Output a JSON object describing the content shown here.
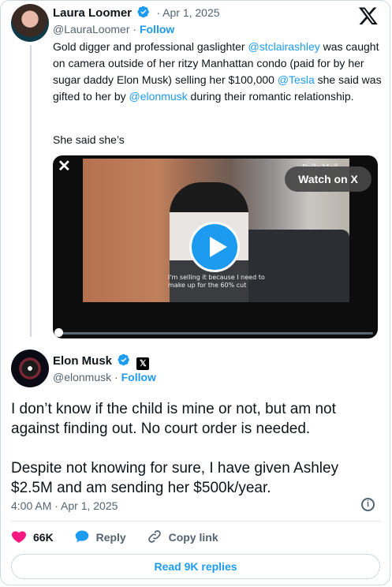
{
  "quoted_tweet": {
    "author_name": "Laura Loomer",
    "date": "· Apr 1, 2025",
    "handle": "@LauraLoomer",
    "separator": "·",
    "follow": "Follow",
    "text_part1": "Gold digger and professional gaslighter ",
    "mention1": "@stclairashley",
    "text_part2": " was caught on camera outside of her ritzy Manhattan condo (paid for by her sugar daddy Elon Musk) selling her $100,000 ",
    "mention2": "@Tesla",
    "text_part3": " she said was gifted to her by ",
    "mention3": "@elonmusk",
    "text_part4": " during their romantic relationship.",
    "text_line2": "She said she’s",
    "video": {
      "watch_label": "Watch on X",
      "subtitle": "I'm selling it because I need to make up for the 60% cut",
      "source_logo": "Daily Mail",
      "progress": 0.01
    }
  },
  "tweet": {
    "author_name": "Elon Musk",
    "handle": "@elonmusk",
    "separator": "·",
    "follow": "Follow",
    "paragraph1": "I don’t know if the child is mine or not, but am not against finding out. No court order is needed.",
    "paragraph2": "Despite not knowing for sure, I have given Ashley $2.5M and am sending her $500k/year.",
    "timestamp": "4:00 AM · Apr 1, 2025"
  },
  "actions": {
    "likes": "66K",
    "reply": "Reply",
    "copy_link": "Copy link"
  },
  "read_replies": "Read 9K replies",
  "colors": {
    "accent": "#1d9bf0",
    "like": "#f91880",
    "text": "#0f1419",
    "muted": "#536471"
  },
  "icons": [
    "x-logo-icon",
    "verified-badge-icon",
    "close-icon",
    "play-icon",
    "info-icon",
    "heart-icon",
    "reply-bubble-icon",
    "link-icon"
  ]
}
